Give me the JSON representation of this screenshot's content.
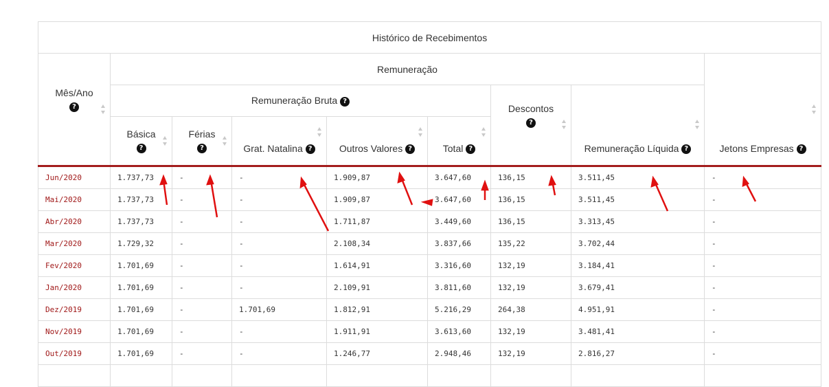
{
  "table": {
    "title": "Histórico de Recebimentos",
    "group_remuneracao": "Remuneração",
    "group_bruta": "Remuneração Bruta",
    "headers": {
      "mes_ano": "Mês/Ano",
      "basica": "Básica",
      "ferias": "Férias",
      "grat_natalina": "Grat. Natalina",
      "outros_valores": "Outros Valores",
      "total": "Total",
      "descontos": "Descontos",
      "liquida": "Remuneração Líquida",
      "jetons": "Jetons Empresas"
    },
    "help_icon": "question-circle-icon",
    "rows": [
      {
        "mes": "Jun/2020",
        "basica": "1.737,73",
        "ferias": "-",
        "grat": "-",
        "outros": "1.909,87",
        "total": "3.647,60",
        "descontos": "136,15",
        "liquida": "3.511,45",
        "jetons": "-"
      },
      {
        "mes": "Mai/2020",
        "basica": "1.737,73",
        "ferias": "-",
        "grat": "-",
        "outros": "1.909,87",
        "total": "3.647,60",
        "descontos": "136,15",
        "liquida": "3.511,45",
        "jetons": "-"
      },
      {
        "mes": "Abr/2020",
        "basica": "1.737,73",
        "ferias": "-",
        "grat": "-",
        "outros": "1.711,87",
        "total": "3.449,60",
        "descontos": "136,15",
        "liquida": "3.313,45",
        "jetons": "-"
      },
      {
        "mes": "Mar/2020",
        "basica": "1.729,32",
        "ferias": "-",
        "grat": "-",
        "outros": "2.108,34",
        "total": "3.837,66",
        "descontos": "135,22",
        "liquida": "3.702,44",
        "jetons": "-"
      },
      {
        "mes": "Fev/2020",
        "basica": "1.701,69",
        "ferias": "-",
        "grat": "-",
        "outros": "1.614,91",
        "total": "3.316,60",
        "descontos": "132,19",
        "liquida": "3.184,41",
        "jetons": "-"
      },
      {
        "mes": "Jan/2020",
        "basica": "1.701,69",
        "ferias": "-",
        "grat": "-",
        "outros": "2.109,91",
        "total": "3.811,60",
        "descontos": "132,19",
        "liquida": "3.679,41",
        "jetons": "-"
      },
      {
        "mes": "Dez/2019",
        "basica": "1.701,69",
        "ferias": "-",
        "grat": "1.701,69",
        "outros": "1.812,91",
        "total": "5.216,29",
        "descontos": "264,38",
        "liquida": "4.951,91",
        "jetons": "-"
      },
      {
        "mes": "Nov/2019",
        "basica": "1.701,69",
        "ferias": "-",
        "grat": "-",
        "outros": "1.911,91",
        "total": "3.613,60",
        "descontos": "132,19",
        "liquida": "3.481,41",
        "jetons": "-"
      },
      {
        "mes": "Out/2019",
        "basica": "1.701,69",
        "ferias": "-",
        "grat": "-",
        "outros": "1.246,77",
        "total": "2.948,46",
        "descontos": "132,19",
        "liquida": "2.816,27",
        "jetons": "-"
      },
      {
        "mes": "",
        "basica": "",
        "ferias": "",
        "grat": "",
        "outros": "",
        "total": "",
        "descontos": "",
        "liquida": "",
        "jetons": ""
      }
    ]
  },
  "colors": {
    "accent": "#a31d1d",
    "month_text": "#a01818",
    "arrow": "#e01010"
  }
}
